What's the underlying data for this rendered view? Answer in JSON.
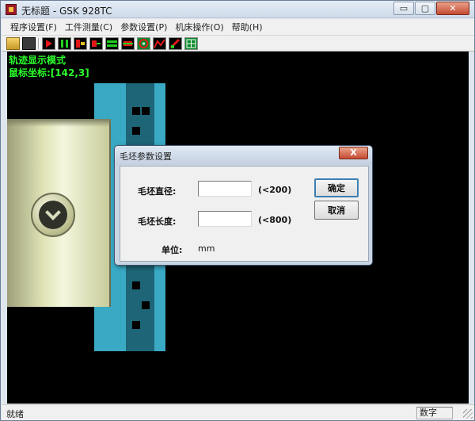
{
  "window": {
    "title": "无标题 - GSK 928TC",
    "controls": {
      "minimize": "▭",
      "maximize": "▢",
      "close": "✕"
    }
  },
  "menu": [
    {
      "label": "程序设置(F)"
    },
    {
      "label": "工件测量(C)"
    },
    {
      "label": "参数设置(P)"
    },
    {
      "label": "机床操作(O)"
    },
    {
      "label": "帮助(H)"
    }
  ],
  "toolbar": {
    "icons": [
      "open-folder-icon",
      "save-icon",
      "play-icon",
      "pause-icon",
      "step-icon",
      "single-block-icon",
      "stock-icon",
      "tool-path-icon",
      "target-icon",
      "graph-icon",
      "tool-icon",
      "grid-icon"
    ]
  },
  "canvas": {
    "mode_label": "轨迹显示模式",
    "coord_label": "鼠标坐标:[142,3]",
    "colors": {
      "background": "#000000",
      "stock": "#39a9c4",
      "stock_dark": "#1d6577",
      "text": "#2bff2b"
    }
  },
  "dialog": {
    "title": "毛坯参数设置",
    "close_label": "X",
    "diameter": {
      "label": "毛坯直径:",
      "value": "",
      "hint": "(<200)"
    },
    "length": {
      "label": "毛坯长度:",
      "value": "",
      "hint": "(<800)"
    },
    "unit": {
      "label": "单位:",
      "value": "mm"
    },
    "ok_label": "确定",
    "cancel_label": "取消"
  },
  "status": {
    "left": "就绪",
    "right": "数字"
  }
}
